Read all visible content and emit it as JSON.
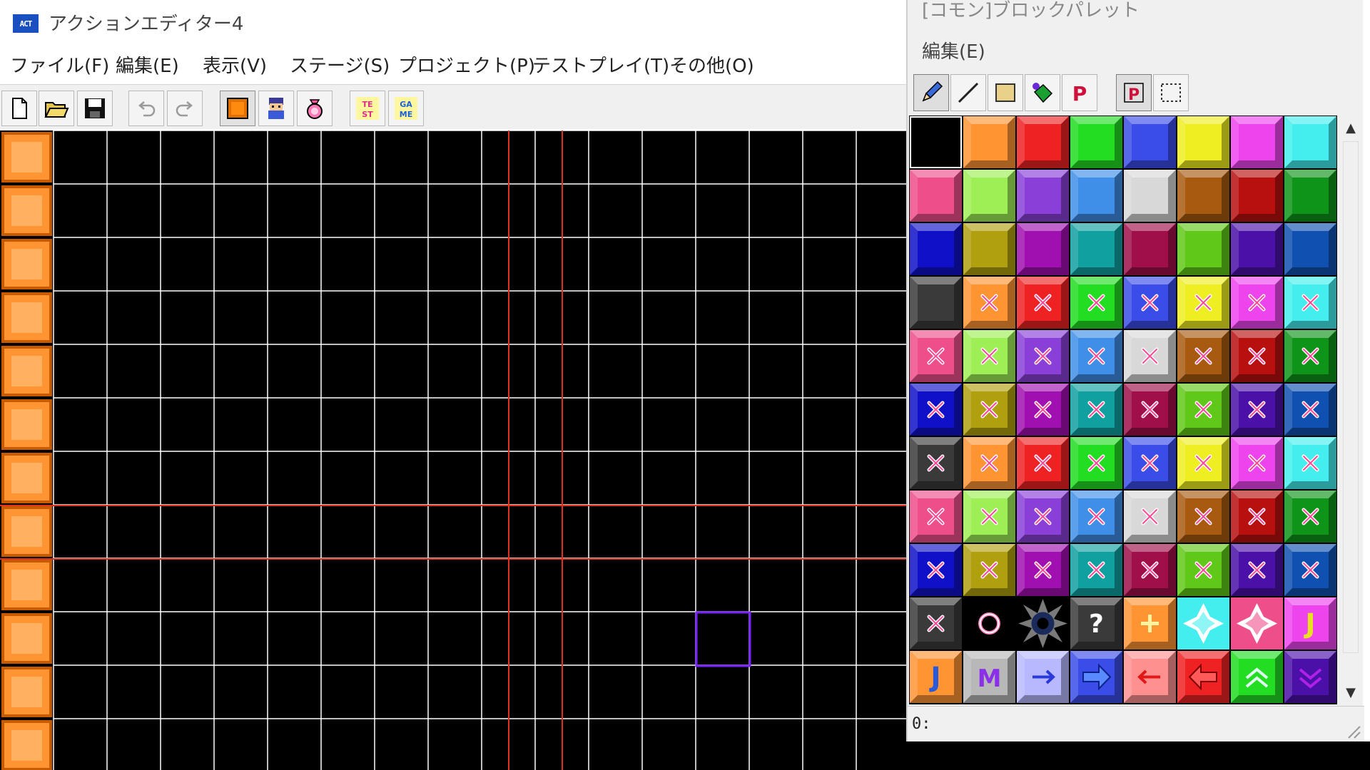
{
  "app": {
    "title": "アクションエディター4",
    "icon_text": "ACT"
  },
  "menu": [
    "ファイル(F)",
    "編集(E)",
    "表示(V)",
    "ステージ(S)",
    "プロジェクト(P)",
    "テストプレイ(T)",
    "その他(O)"
  ],
  "toolbar": {
    "buttons": [
      "new-file-icon",
      "open-folder-icon",
      "save-icon",
      "undo-icon",
      "redo-icon",
      "block-layer-icon",
      "character-layer-icon",
      "item-layer-icon",
      "test-play-icon",
      "game-icon"
    ],
    "test_label": "TE ST",
    "game_label": "GA ME"
  },
  "palette": {
    "title": "[コモン]ブロックパレット",
    "menu_edit": "編集(E)",
    "tools": [
      "pencil-icon",
      "line-icon",
      "rectangle-icon",
      "fill-icon",
      "p-icon",
      "p-selected-icon",
      "select-rect-icon"
    ],
    "status": "0:",
    "rows": [
      [
        "black:#000000",
        "plain:#ff9433",
        "plain:#ee2222",
        "plain:#22dd22",
        "plain:#3a4de8",
        "plain:#eeee22",
        "plain:#ee44ee",
        "plain:#44eeee"
      ],
      [
        "plain:#ee4f8b",
        "plain:#9eee55",
        "plain:#8a3fd8",
        "plain:#3f8ee8",
        "plain:#d8d8d8",
        "plain:#a85a10",
        "plain:#b80f0f",
        "plain:#0e9418"
      ],
      [
        "plain:#1010c8",
        "plain:#b0a010",
        "plain:#a010b0",
        "plain:#10a0a0",
        "plain:#a00f4a",
        "plain:#60c818",
        "plain:#4a10a8",
        "plain:#1050b0"
      ],
      [
        "plain:#3a3a3a",
        "x:#ff9433",
        "x:#ee2222",
        "x:#22dd22",
        "x:#3a4de8",
        "x:#eeee22",
        "x:#ee44ee",
        "x:#44eeee"
      ],
      [
        "x:#ee4f8b",
        "x:#9eee55",
        "x:#8a3fd8",
        "x:#3f8ee8",
        "x:#d8d8d8",
        "x:#a85a10",
        "x:#b80f0f",
        "x:#0e9418"
      ],
      [
        "x:#1010c8",
        "x:#b0a010",
        "x:#a010b0",
        "x:#10a0a0",
        "x:#a00f4a",
        "x:#60c818",
        "x:#4a10a8",
        "x:#1050b0"
      ],
      [
        "x:#3a3a3a",
        "x:#ff9433",
        "x:#ee2222",
        "x:#22dd22",
        "x:#3a4de8",
        "x:#eeee22",
        "x:#ee44ee",
        "x:#44eeee"
      ],
      [
        "x:#ee4f8b",
        "x:#9eee55",
        "x:#8a3fd8",
        "x:#3f8ee8",
        "x:#d8d8d8",
        "x:#a85a10",
        "x:#b80f0f",
        "x:#0e9418"
      ],
      [
        "x:#1010c8",
        "x:#b0a010",
        "x:#a010b0",
        "x:#10a0a0",
        "x:#a00f4a",
        "x:#60c818",
        "x:#4a10a8",
        "x:#1050b0"
      ],
      [
        "x:#3a3a3a",
        "circle:#000000",
        "spike:#000000",
        "question:#3a3a3a",
        "plus:#ff9433",
        "star:#44eeee",
        "star:#ee4f8b",
        "letter-j:#ee44ee"
      ],
      [
        "letter-j:#ff9433",
        "letter-m:#b8b8b8",
        "arrow-right:#b8b8ff",
        "arrow-right-bold:#3a4de8",
        "arrow-left:#ff9090",
        "arrow-left-bold:#ee2222",
        "chevron-up:#22dd22",
        "chevron-down:#4a10a8"
      ]
    ]
  },
  "colors": {
    "map_bg": "#000000",
    "grid": "#ffffff",
    "guide": "#e03020",
    "wall": "#ff9433",
    "cursor": "#7a22ff"
  }
}
